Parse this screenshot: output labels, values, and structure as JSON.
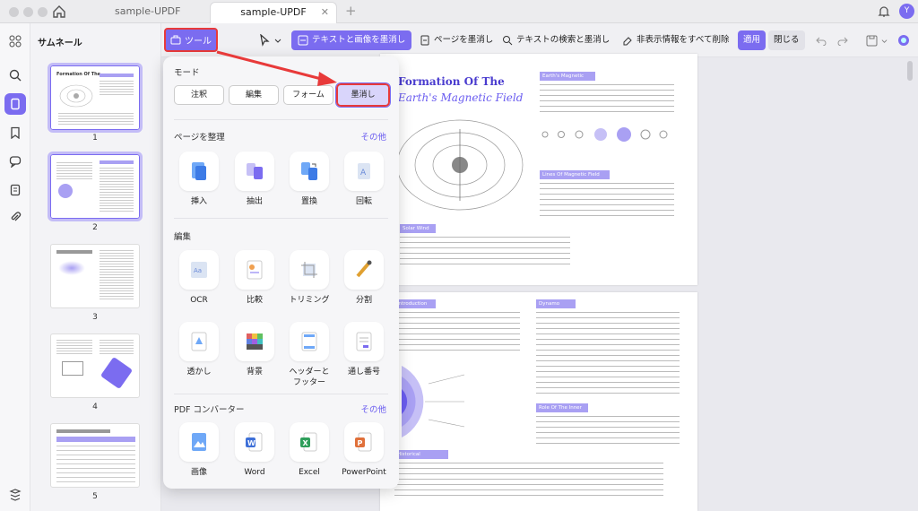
{
  "window": {
    "tabs": [
      "sample-UPDF",
      "sample-UPDF"
    ],
    "tab_close": "✕",
    "tab_add": "+",
    "avatar_initial": "Y"
  },
  "toolbar": {
    "tools_label": "ツール",
    "redact_text_image": "テキストと画像を墨消し",
    "redact_page": "ページを墨消し",
    "search_redact": "テキストの検索と墨消し",
    "remove_hidden": "非表示情報をすべて削除",
    "apply": "適用",
    "close": "閉じる"
  },
  "sidebar": {
    "title": "サムネール",
    "pages": [
      "1",
      "2",
      "3",
      "4",
      "5"
    ]
  },
  "popup": {
    "mode_title": "モード",
    "modes": [
      "注釈",
      "編集",
      "フォーム",
      "墨消し"
    ],
    "organize_title": "ページを整理",
    "organize_more": "その他",
    "organize_items": [
      "挿入",
      "抽出",
      "置換",
      "回転"
    ],
    "edit_title": "編集",
    "edit_items": [
      "OCR",
      "比較",
      "トリミング",
      "分割",
      "透かし",
      "背景",
      "ヘッダーと\nフッター",
      "通し番号"
    ],
    "converter_title": "PDF コンバーター",
    "converter_more": "その他",
    "converter_items": [
      "画像",
      "Word",
      "Excel",
      "PowerPoint"
    ]
  },
  "document": {
    "title_line1": "Formation Of The",
    "title_line2": "Earth's Magnetic Field",
    "heading1": "Earth's Magnetic",
    "heading2": "Lines Of Magnetic Field",
    "heading3": "Solar Wind",
    "heading4": "Dynamo Theory",
    "heading5": "Role Of The Inner Core",
    "heading6": "Historical Perspectives",
    "heading7": "Introduction"
  },
  "colors": {
    "accent": "#7b6cf0",
    "highlight": "#e83a3a"
  }
}
